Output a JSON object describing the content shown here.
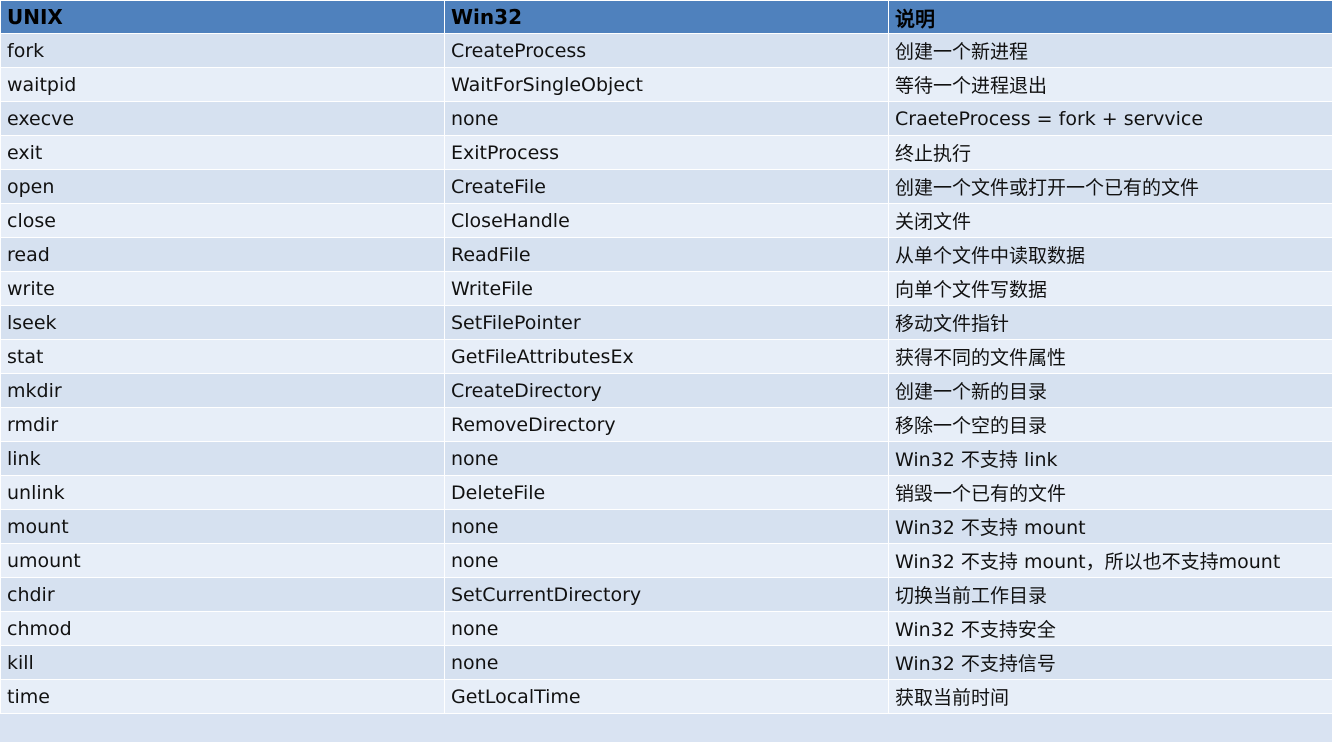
{
  "table": {
    "headers": [
      "UNIX",
      "Win32",
      "说明"
    ],
    "rows": [
      [
        "fork",
        "CreateProcess",
        "创建一个新进程"
      ],
      [
        "waitpid",
        "WaitForSingleObject",
        "等待一个进程退出"
      ],
      [
        "execve",
        "none",
        "CraeteProcess = fork + servvice"
      ],
      [
        "exit",
        "ExitProcess",
        "终止执行"
      ],
      [
        "open",
        "CreateFile",
        "创建一个文件或打开一个已有的文件"
      ],
      [
        "close",
        "CloseHandle",
        "关闭文件"
      ],
      [
        "read",
        "ReadFile",
        "从单个文件中读取数据"
      ],
      [
        "write",
        "WriteFile",
        "向单个文件写数据"
      ],
      [
        "lseek",
        "SetFilePointer",
        "移动文件指针"
      ],
      [
        "stat",
        "GetFileAttributesEx",
        "获得不同的文件属性"
      ],
      [
        "mkdir",
        "CreateDirectory",
        "创建一个新的目录"
      ],
      [
        "rmdir",
        "RemoveDirectory",
        "移除一个空的目录"
      ],
      [
        "link",
        "none",
        "Win32 不支持 link"
      ],
      [
        "unlink",
        "DeleteFile",
        "销毁一个已有的文件"
      ],
      [
        "mount",
        "none",
        "Win32 不支持 mount"
      ],
      [
        "umount",
        "none",
        "Win32 不支持 mount，所以也不支持mount"
      ],
      [
        "chdir",
        "SetCurrentDirectory",
        "切换当前工作目录"
      ],
      [
        "chmod",
        "none",
        "Win32 不支持安全"
      ],
      [
        "kill",
        "none",
        "Win32 不支持信号"
      ],
      [
        "time",
        "GetLocalTime",
        "获取当前时间"
      ]
    ]
  },
  "colors": {
    "header_bg": "#4f81bd",
    "row_bg_a": "#d6e1f0",
    "row_bg_b": "#e7eef8",
    "border": "#ffffff"
  }
}
